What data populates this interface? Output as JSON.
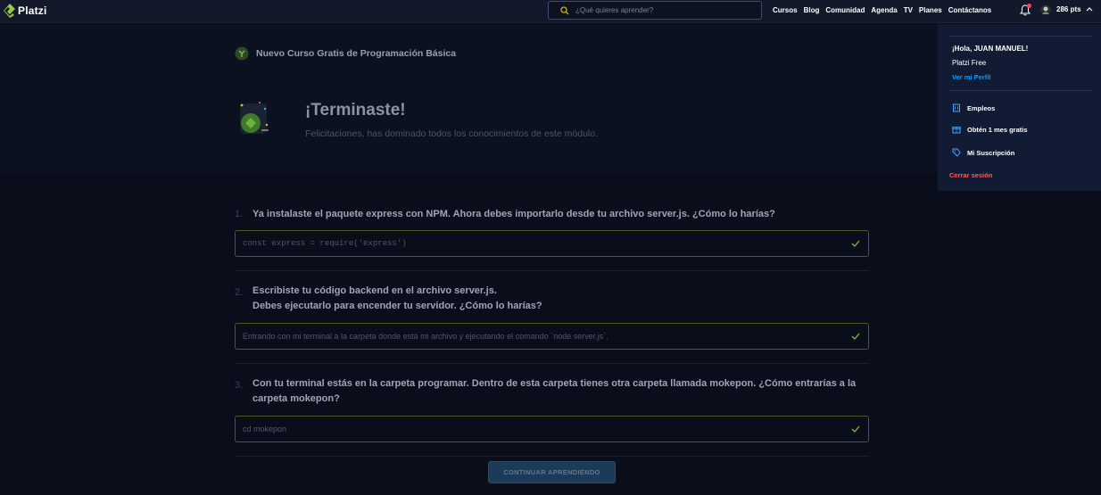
{
  "header": {
    "logo_text": "Platzi",
    "search_placeholder": "¿Qué quieres aprender?",
    "nav": [
      "Cursos",
      "Blog",
      "Comunidad",
      "Agenda",
      "TV",
      "Planes",
      "Contáctanos"
    ],
    "points": "286 pts"
  },
  "hero": {
    "course_title": "Nuevo Curso Gratis de Programación Básica",
    "title": "¡Terminaste!",
    "subtitle": "Felicitaciones, has dominado todos los conocimientos de este módulo."
  },
  "questions": [
    {
      "number": "1.",
      "text": "Ya instalaste el paquete express con NPM. Ahora debes importarlo desde tu archivo server.js. ¿Cómo lo harías?",
      "answer": "const express = require('express')"
    },
    {
      "number": "2.",
      "text_line1": "Escribiste tu código backend en el archivo server.js.",
      "text_line2": "Debes ejecutarlo para encender tu servidor. ¿Cómo lo harías?",
      "answer": "Entrando con mi terminal a la carpeta donde está mi archivo y ejecutando el comando `node server.js`."
    },
    {
      "number": "3.",
      "text": "Con tu terminal estás en la carpeta programar. Dentro de esta carpeta tienes otra carpeta llamada mokepon. ¿Cómo entrarías a la carpeta mokepon?",
      "answer": "cd mokepon"
    }
  ],
  "continue_button": "CONTINUAR APRENDIENDO",
  "dropdown": {
    "greeting": "¡Hola, JUAN MANUEL!",
    "plan": "Platzi Free",
    "profile_link": "Ver mi Perfil",
    "items": [
      "Empleos",
      "Obtén 1 mes gratis",
      "Mi Suscripción"
    ],
    "logout": "Cerrar sesión"
  },
  "colors": {
    "background": "#0a0e1a",
    "brand_green": "#98ca3f",
    "link_blue": "#0c9bff",
    "logout_red": "#ff5a5f",
    "answer_border": "#4b5c23"
  }
}
